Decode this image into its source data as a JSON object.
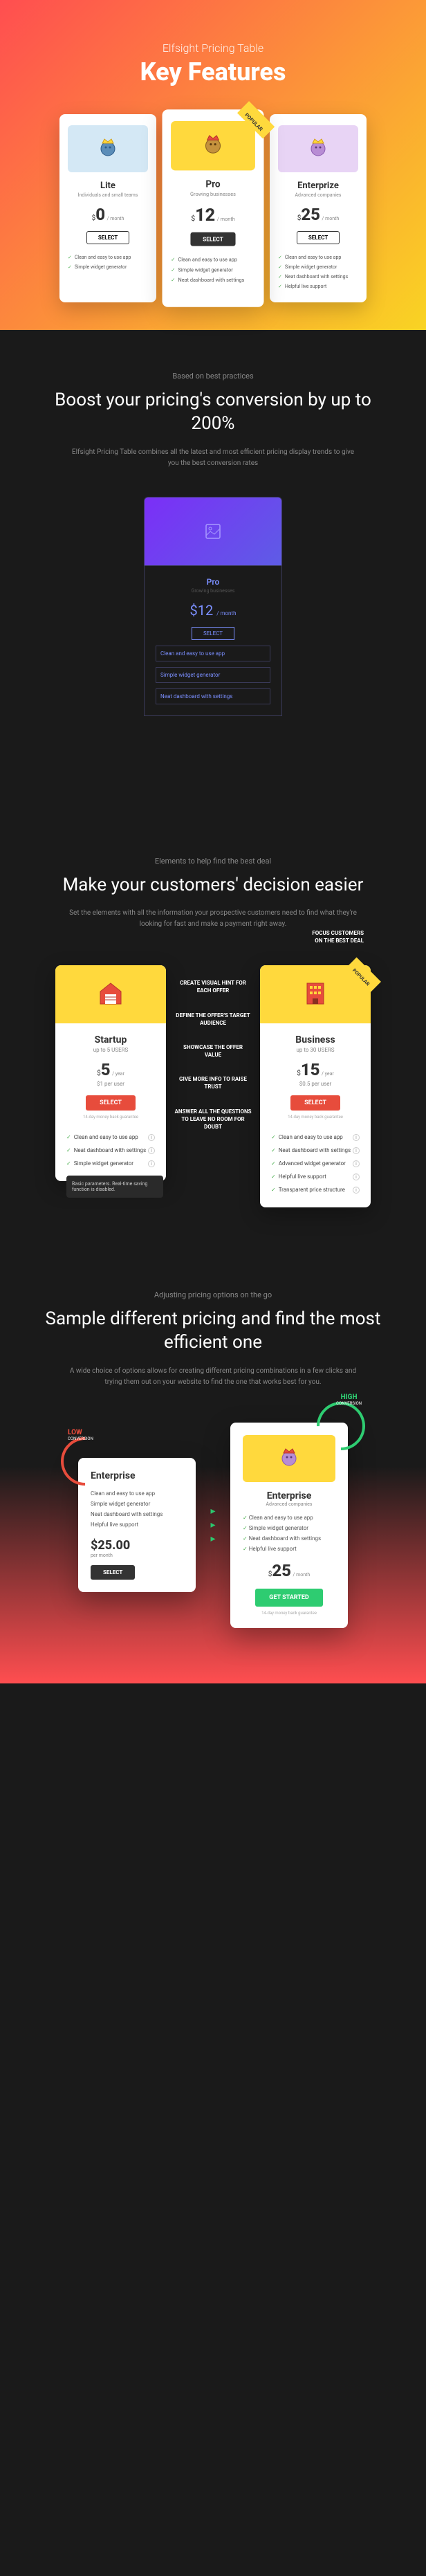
{
  "hero": {
    "subtitle": "Elfsight Pricing Table",
    "title": "Key Features"
  },
  "plans": [
    {
      "name": "Lite",
      "sub": "Individuals and small teams",
      "price": "0",
      "unit": "/ month",
      "btn": "SELECT",
      "features": [
        "Clean and easy to use app",
        "Simple widget generator"
      ]
    },
    {
      "name": "Pro",
      "sub": "Growing businesses",
      "price": "12",
      "unit": "/ month",
      "btn": "SELECT",
      "badge": "POPULAR",
      "features": [
        "Clean and easy to use app",
        "Simple widget generator",
        "Neat dashboard with settings"
      ]
    },
    {
      "name": "Enterprize",
      "sub": "Advanced companies",
      "price": "25",
      "unit": "/ month",
      "btn": "SELECT",
      "features": [
        "Clean and easy to use app",
        "Simple widget generator",
        "Neat dashboard with settings",
        "Helpful live support"
      ]
    }
  ],
  "sec1": {
    "eyebrow": "Based on best practices",
    "title": "Boost your pricing's conversion by up to 200%",
    "desc": "Elfsight Pricing Table combines all the latest and most efficient pricing display trends to give you the best conversion rates"
  },
  "wireframe": {
    "name": "Pro",
    "sub": "Growing businesses",
    "price": "12",
    "unit": "/ month",
    "btn": "SELECT",
    "features": [
      "Clean and easy to use app",
      "Simple widget generator",
      "Neat dashboard with settings"
    ]
  },
  "sec2": {
    "eyebrow": "Elements to help find the best deal",
    "title": "Make your customers' decision easier",
    "desc": "Set the elements with all the information your prospective customers need to find what they're looking for fast and make a payment right away.",
    "focus": "FOCUS CUSTOMERS\nON THE BEST DEAL"
  },
  "callouts": [
    "CREATE VISUAL HINT FOR EACH OFFER",
    "DEFINE THE OFFER'S TARGET AUDIENCE",
    "SHOWCASE THE OFFER VALUE",
    "GIVE MORE INFO TO RAISE TRUST",
    "ANSWER ALL THE QUESTIONS TO LEAVE NO ROOM FOR DOUBT"
  ],
  "comp": [
    {
      "name": "Startup",
      "sub": "up to 5 USERS",
      "price": "5",
      "unit": "/ year",
      "perUser": "$1 per user",
      "btn": "SELECT",
      "guarantee": "14-day money back guarantee",
      "features": [
        "Clean and easy to use app",
        "Neat dashboard with settings",
        "Simple widget generator"
      ],
      "tooltip": "Basic parameters. Real-time saving function is disabled."
    },
    {
      "name": "Business",
      "sub": "up to 30 USERS",
      "price": "15",
      "unit": "/ year",
      "perUser": "$0.5 per user",
      "btn": "SELECT",
      "badge": "POPULAR",
      "guarantee": "14-day money back guarantee",
      "features": [
        "Clean and easy to use app",
        "Neat dashboard with settings",
        "Advanced widget generator",
        "Helpful live support",
        "Transparent price structure"
      ]
    }
  ],
  "sec3": {
    "eyebrow": "Adjusting pricing options on the go",
    "title": "Sample different pricing and find the most efficient one",
    "desc": "A wide choice of options allows for creating different pricing combinations in a few clicks and trying them out on your website to find the one that works best for you."
  },
  "conv": {
    "low": {
      "label": "LOW",
      "sub": "CONVERSION",
      "name": "Enterprise",
      "features": [
        "Clean and easy to use app",
        "Simple widget generator",
        "Neat dashboard with settings",
        "Helpful live support"
      ],
      "price": "$25.00",
      "unit": "per month",
      "btn": "SELECT"
    },
    "high": {
      "label": "HIGH",
      "sub": "CONVERSION",
      "name": "Enterprise",
      "nameSub": "Advanced companies",
      "features": [
        "Clean and easy to use app",
        "Simple widget generator",
        "Neat dashboard with settings",
        "Helpful live support"
      ],
      "price": "25",
      "unit": "/ month",
      "btn": "GET STARTED",
      "guarantee": "14-day money back guarantee"
    }
  }
}
